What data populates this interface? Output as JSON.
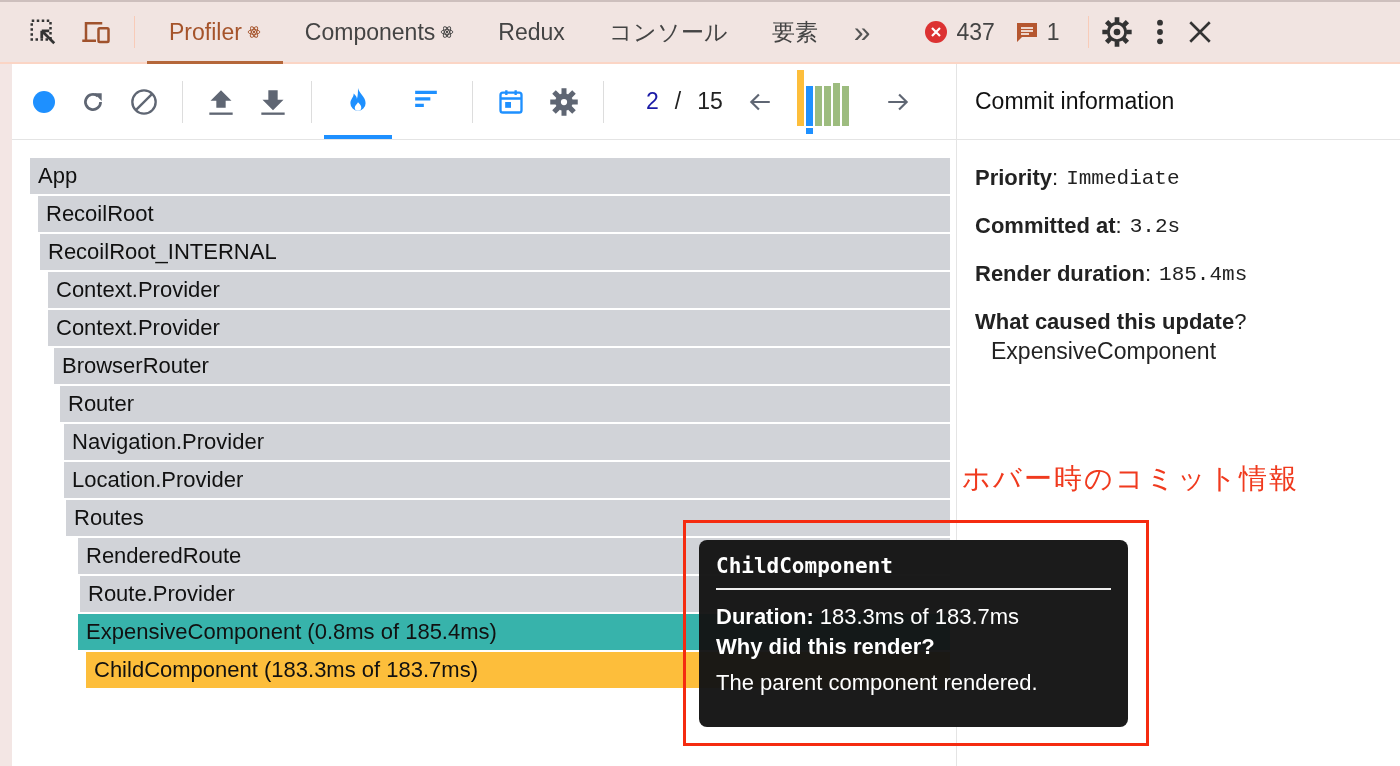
{
  "tabs": [
    {
      "label": "Profiler",
      "selected": true,
      "react": true
    },
    {
      "label": "Components",
      "selected": false,
      "react": true
    },
    {
      "label": "Redux",
      "selected": false,
      "react": false
    },
    {
      "label": "コンソール",
      "selected": false,
      "react": false
    },
    {
      "label": "要素",
      "selected": false,
      "react": false
    }
  ],
  "more_tabs": "»",
  "counters": {
    "errors": "437",
    "messages": "1"
  },
  "toolbar": {
    "views": [
      {
        "kind": "flame",
        "selected": true
      },
      {
        "kind": "ranked",
        "selected": false
      }
    ],
    "commit_index": "2",
    "separator": "/",
    "commit_total": "15"
  },
  "flame_rows": [
    {
      "name": "App",
      "color": "#d1d3d8",
      "children": [
        {
          "name": "RecoilRoot",
          "color": "#d1d3d8",
          "children": [
            {
              "name": "RecoilRoot_INTERNAL",
              "color": "#d1d3d8",
              "children": [
                {
                  "name": "Context.Provider",
                  "color": "#d1d3d8",
                  "children": [
                    {
                      "name": "Context.Provider",
                      "color": "#d1d3d8",
                      "children": [
                        {
                          "name": "BrowserRouter",
                          "color": "#d1d3d8",
                          "children": [
                            {
                              "name": "Router",
                              "color": "#d1d3d8",
                              "children": [
                                {
                                  "name": "Navigation.Provider",
                                  "color": "#d1d3d8",
                                  "children": [
                                    {
                                      "name": "Location.Provider",
                                      "color": "#d1d3d8",
                                      "children": [
                                        {
                                          "name": "Routes",
                                          "color": "#d1d3d8",
                                          "children": [
                                            {
                                              "name": "RenderedRoute",
                                              "color": "#d1d3d8",
                                              "children": [
                                                {
                                                  "name": "Route.Provider",
                                                  "color": "#d1d3d8",
                                                  "children": [
                                                    {
                                                      "name": "ExpensiveComponent (0.8ms of 185.4ms)",
                                                      "color": "#37b3ab",
                                                      "children": [
                                                        {
                                                          "name": "ChildComponent (183.3ms of 183.7ms)",
                                                          "color": "#fdbe3b"
                                                        }
                                                      ]
                                                    }
                                                  ]
                                                }
                                              ]
                                            }
                                          ]
                                        }
                                      ]
                                    }
                                  ]
                                }
                              ]
                            }
                          ]
                        }
                      ]
                    }
                  ]
                }
              ]
            }
          ]
        }
      ]
    }
  ],
  "commit_info": {
    "title": "Commit information",
    "fields": [
      {
        "label": "Priority",
        "colon": ":",
        "value": "Immediate"
      },
      {
        "label": "Committed at",
        "colon": ":",
        "value": "3.2s"
      },
      {
        "label": "Render duration",
        "colon": ":",
        "value": "185.4ms"
      }
    ],
    "cause_label": "What caused this update",
    "cause_mark": "?",
    "cause": "ExpensiveComponent"
  },
  "tooltip": {
    "title": "ChildComponent",
    "duration_label": "Duration:",
    "duration": "183.3ms of 183.7ms",
    "why_label": "Why did this render?",
    "reason": "The parent component rendered."
  },
  "annotation": "ホバー時のコミット情報"
}
